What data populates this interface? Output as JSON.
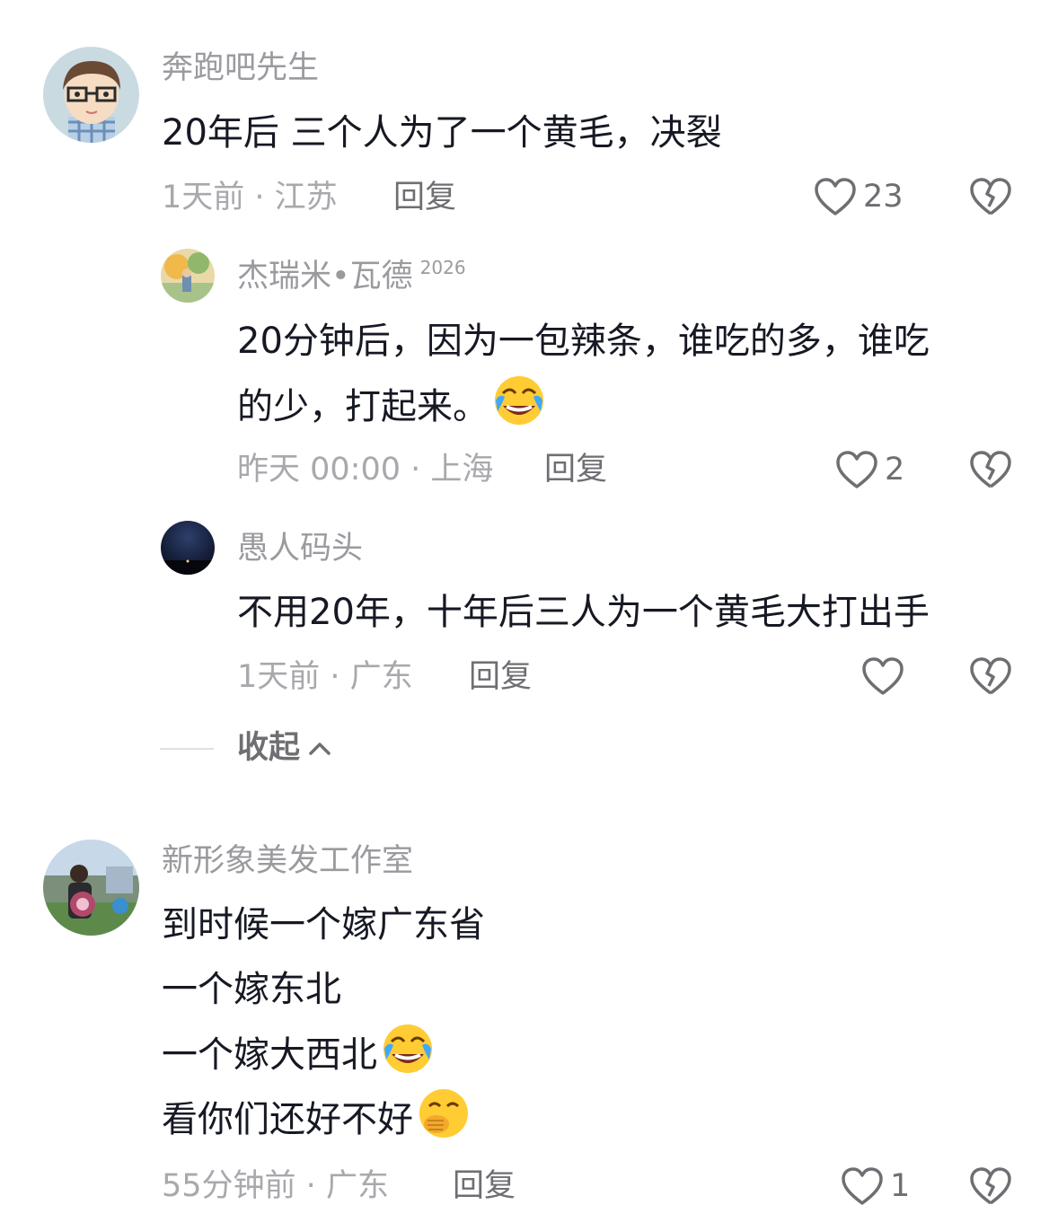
{
  "comments": [
    {
      "username": "奔跑吧先生",
      "text_lines": [
        "20年后  三个人为了一个黄毛，决裂"
      ],
      "time": "1天前",
      "location": "江苏",
      "reply_label": "回复",
      "like_count": "23"
    },
    {
      "username": "杰瑞米•瓦德",
      "badge": "2026",
      "text_lines": [
        "20分钟后，因为一包辣条，谁吃的多，谁吃",
        "的少，打起来。"
      ],
      "emoji": "crying-laughing-face",
      "time": "昨天 00:00",
      "location": "上海",
      "reply_label": "回复",
      "like_count": "2"
    },
    {
      "username": "愚人码头",
      "text_lines": [
        "不用20年，十年后三人为一个黄毛大打出手"
      ],
      "time": "1天前",
      "location": "广东",
      "reply_label": "回复",
      "like_count": ""
    },
    {
      "username": "新形象美发工作室",
      "text_lines": [
        "到时候一个嫁广东省",
        "一个嫁东北",
        "一个嫁大西北",
        "看你们还好不好"
      ],
      "emojis": [
        "crying-laughing-face",
        "hand-over-mouth-face"
      ],
      "time": "55分钟前",
      "location": "广东",
      "reply_label": "回复",
      "like_count": "1"
    }
  ],
  "collapse": {
    "label": "收起",
    "icon": "chevron-up-icon"
  },
  "meta_separator": " · ",
  "colors": {
    "username": "#9a9a9f",
    "text": "#161823",
    "meta": "#a8a8ad",
    "action": "#6e6e73"
  }
}
